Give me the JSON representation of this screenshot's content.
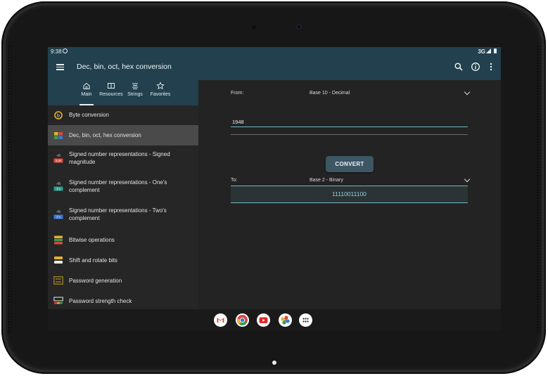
{
  "status": {
    "time": "9:38",
    "network": "3G"
  },
  "appbar": {
    "title": "Dec, bin, oct, hex conversion"
  },
  "tabs": [
    {
      "label": "Main",
      "icon": "home-icon"
    },
    {
      "label": "Resources",
      "icon": "book-icon"
    },
    {
      "label": "Strings",
      "icon": "strings-icon"
    },
    {
      "label": "Favorites",
      "icon": "star-icon"
    }
  ],
  "nav": [
    {
      "label": "Byte conversion",
      "icon": "byte-icon"
    },
    {
      "label": "Dec, bin, oct, hex conversion",
      "icon": "grid-icon"
    },
    {
      "label": "Signed number representations - Signed magnitude",
      "icon": "signed-magnitude-icon",
      "badge": "S-M"
    },
    {
      "label": "Signed number representations - One's complement",
      "icon": "ones-complement-icon",
      "badge": "1's"
    },
    {
      "label": "Signed number representations - Two's complement",
      "icon": "twos-complement-icon",
      "badge": "2's"
    },
    {
      "label": "Bitwise operations",
      "icon": "bitwise-icon"
    },
    {
      "label": "Shift and rotate bits",
      "icon": "shift-icon"
    },
    {
      "label": "Password generation",
      "icon": "password-gen-icon"
    },
    {
      "label": "Password strength check",
      "icon": "password-strength-icon"
    }
  ],
  "converter": {
    "from_label": "From:",
    "from_value": "Base 10 - Decimal",
    "input_value": "1948",
    "to_label": "To:",
    "to_value": "Base 2 - Binary",
    "convert_label": "CONVERT",
    "result": "11110011100"
  },
  "dock": [
    "gmail-icon",
    "chrome-icon",
    "youtube-icon",
    "photos-icon",
    "app-drawer-icon"
  ],
  "colors": {
    "appbar": "#22404e",
    "accent": "#6fb7c4",
    "button": "#3c5664",
    "background": "#212121"
  }
}
